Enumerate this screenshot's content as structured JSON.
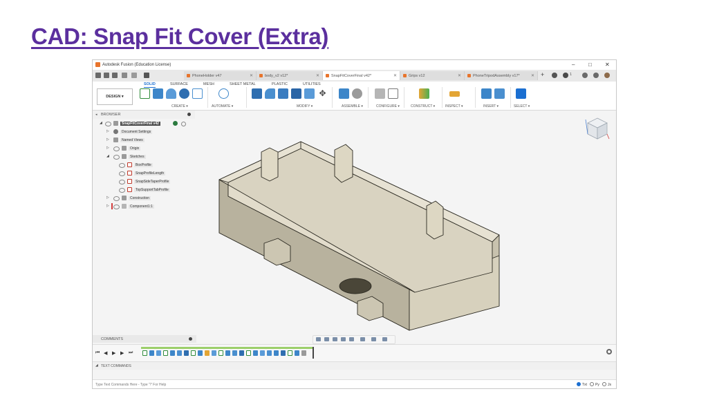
{
  "slide": {
    "title": "CAD: Snap Fit Cover (Extra)"
  },
  "window": {
    "title": "Autodesk Fusion (Education License)",
    "controls": [
      "–",
      "□",
      "✕"
    ]
  },
  "doc_tabs": [
    {
      "label": "PhoneHolder v47",
      "active": false
    },
    {
      "label": "body_v2 v12*",
      "active": false
    },
    {
      "label": "SnapFitCoverFinal v42*",
      "active": true
    },
    {
      "label": "Grips v12",
      "active": false
    },
    {
      "label": "PhoneTripodAssembly v17*",
      "active": false
    }
  ],
  "user": {
    "notifications": "1"
  },
  "ribbon": {
    "workspace": "DESIGN ▾",
    "tabs": [
      "SOLID",
      "SURFACE",
      "MESH",
      "SHEET METAL",
      "PLASTIC",
      "UTILITIES"
    ],
    "active_tab": "SOLID",
    "groups": [
      "CREATE ▾",
      "AUTOMATE ▾",
      "MODIFY ▾",
      "ASSEMBLE ▾",
      "CONFIGURE ▾",
      "CONSTRUCT ▾",
      "INSPECT ▾",
      "INSERT ▾",
      "SELECT ▾"
    ]
  },
  "browser": {
    "title": "BROWSER",
    "root": "SnapFitCoverFinal v42",
    "items": [
      "Document Settings",
      "Named Views",
      "Origin",
      "Sketches",
      "BoxProfile",
      "SnapProfileLength",
      "SnapSideTaperProfile",
      "TopSupportTabProfile",
      "Construction",
      "Component1:1"
    ]
  },
  "comments": {
    "title": "COMMENTS"
  },
  "text_commands": {
    "title": "TEXT COMMANDS",
    "placeholder": "Type Text Commands Here - Type '?' For Help",
    "modes": [
      "Txt",
      "Py",
      "Js"
    ]
  },
  "colors": {
    "accent": "#1b6fd1",
    "title": "#5b2f9e",
    "model": "#d8d2c0"
  }
}
